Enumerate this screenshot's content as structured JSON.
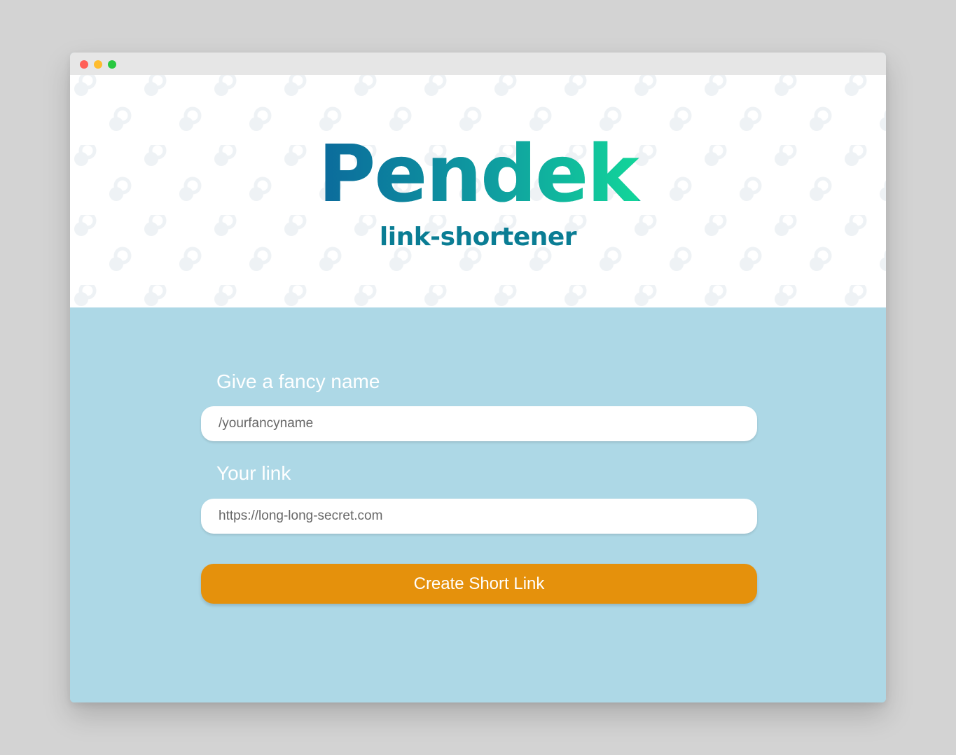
{
  "window": {
    "traffic_lights": [
      "close",
      "minimize",
      "maximize"
    ]
  },
  "hero": {
    "brand": "Pendek",
    "tagline": "link-shortener",
    "pattern_icon": "link-icon"
  },
  "form": {
    "name_label": "Give a fancy name",
    "name_placeholder": "/yourfancyname",
    "link_label": "Your link",
    "link_placeholder": "https://long-long-secret.com",
    "submit_label": "Create Short Link"
  },
  "colors": {
    "page_bg": "#d3d3d3",
    "form_bg": "#add8e6",
    "brand_gradient_start": "#0b6a9c",
    "brand_gradient_end": "#12d59a",
    "tagline": "#0a7d94",
    "button": "#e5910c"
  }
}
